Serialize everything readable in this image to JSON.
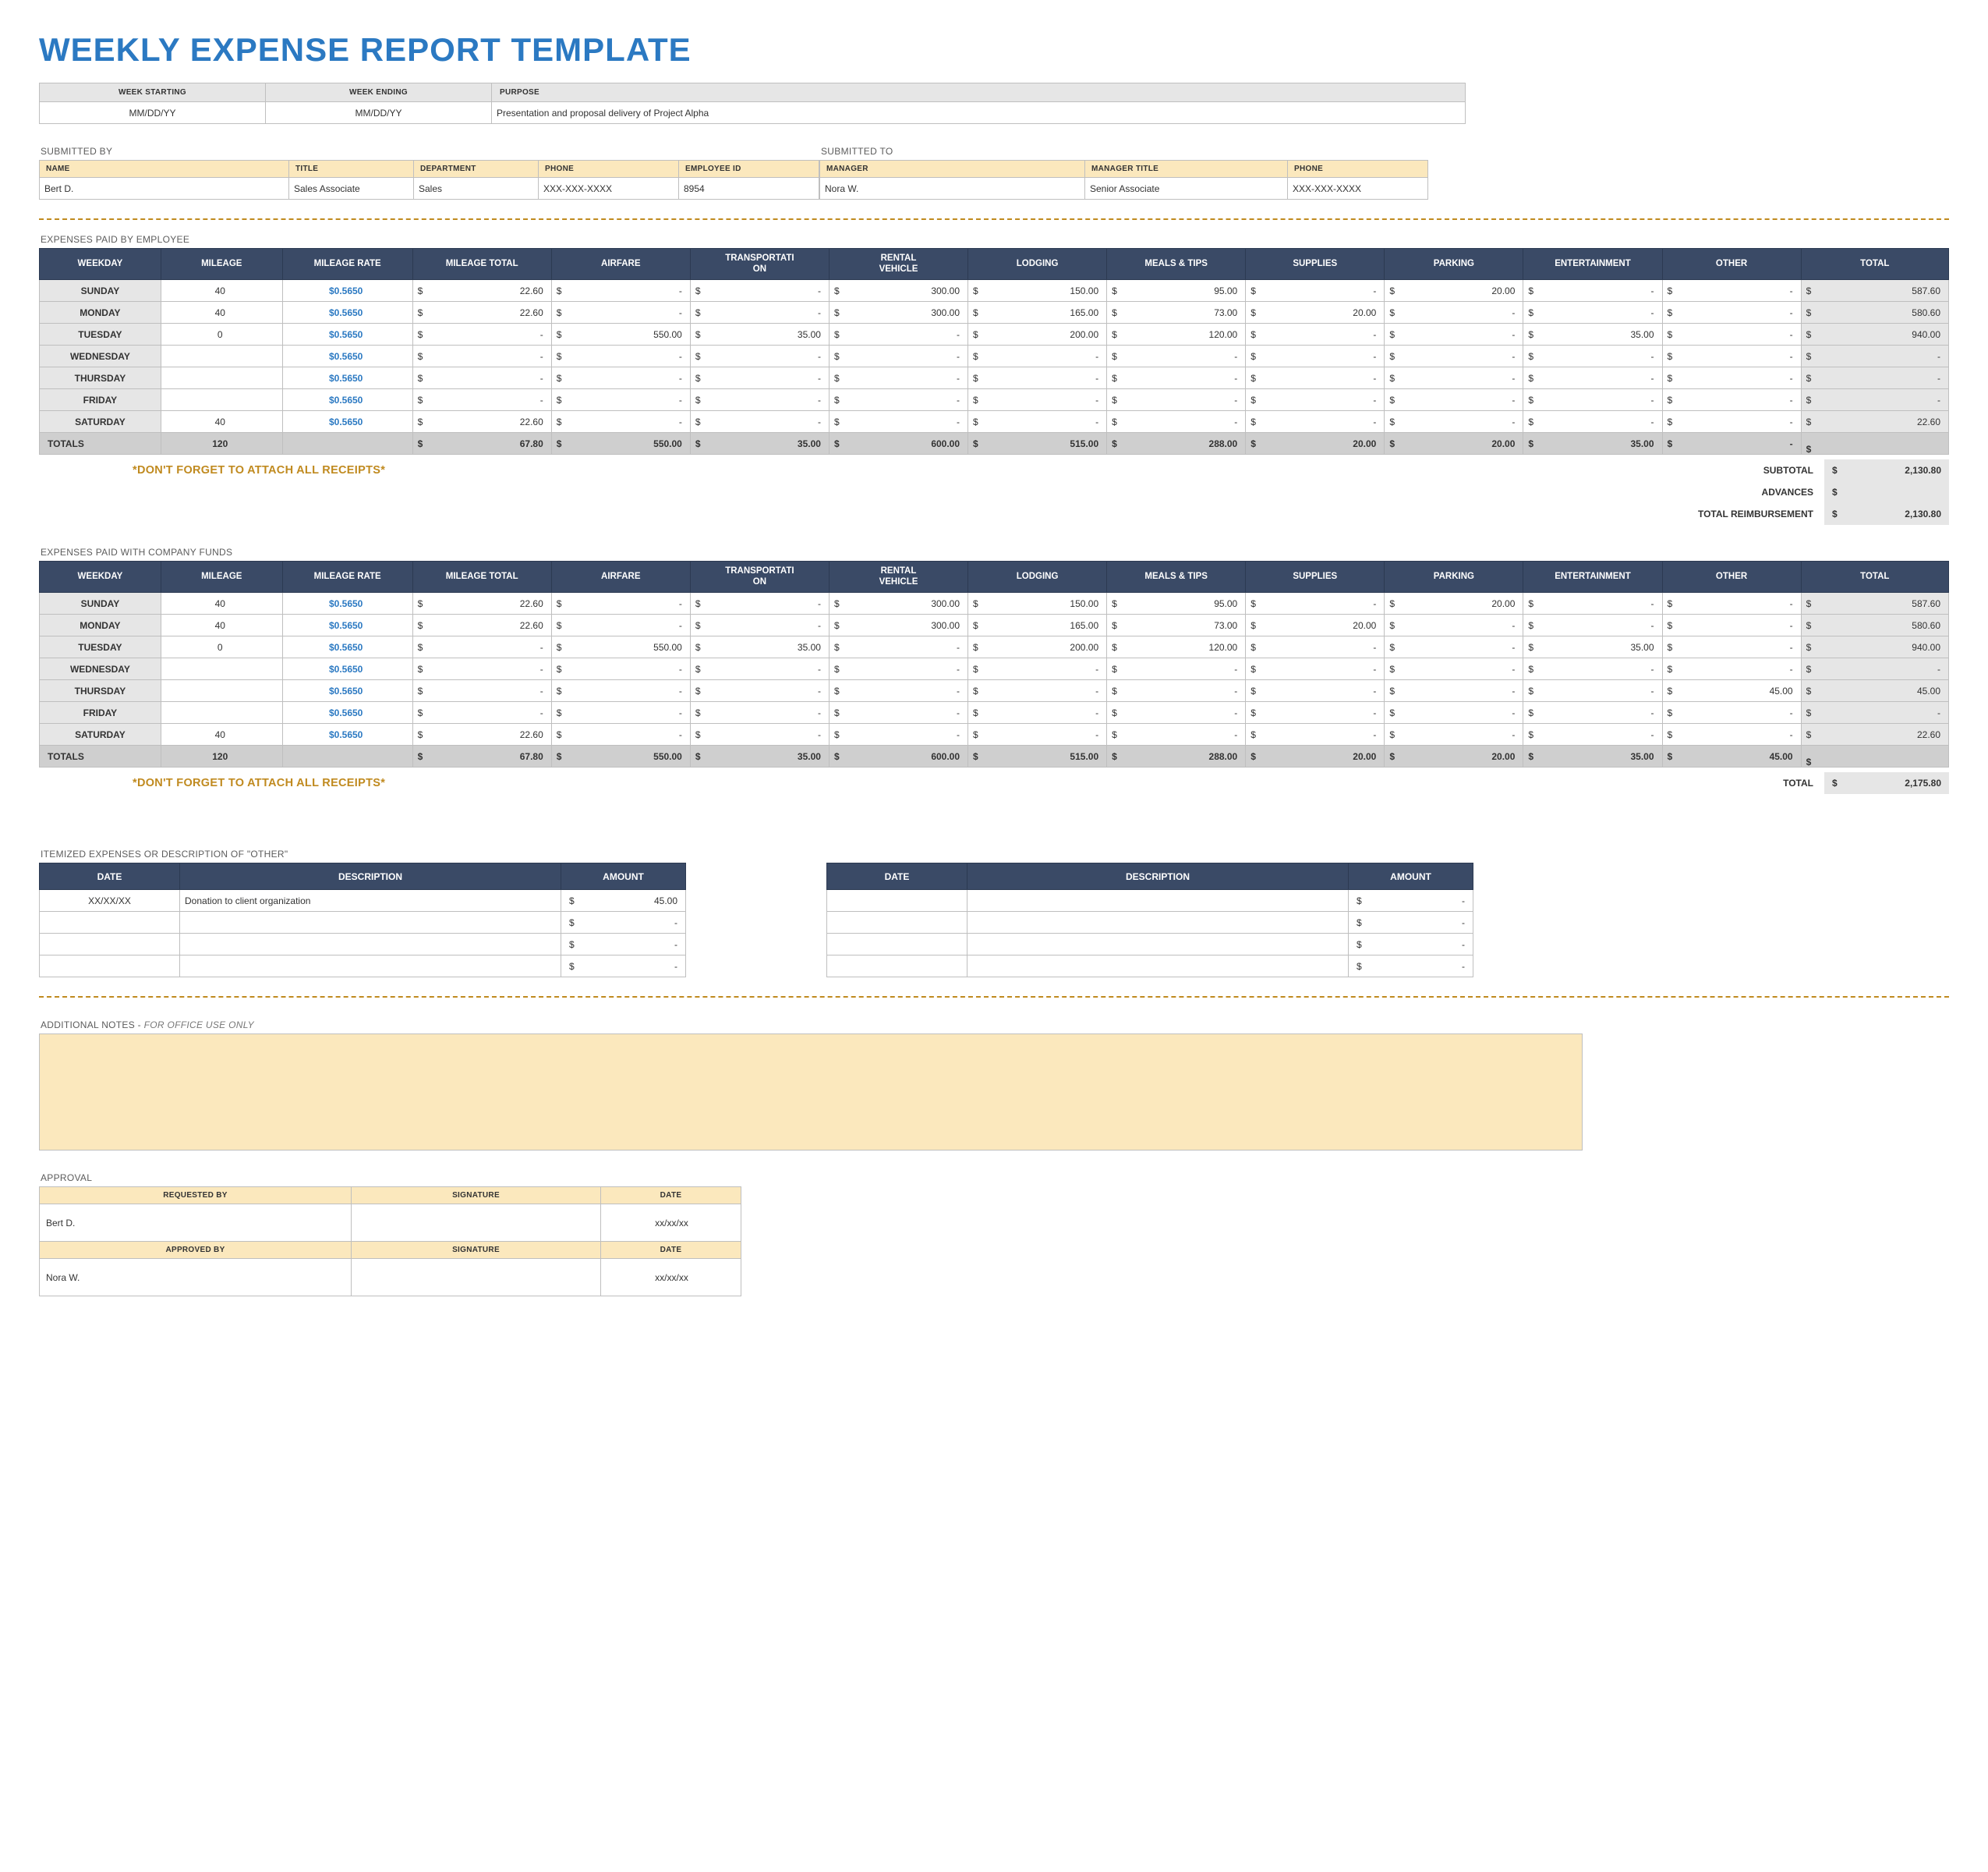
{
  "title": "WEEKLY EXPENSE REPORT TEMPLATE",
  "meta": {
    "labels": {
      "week_start": "WEEK STARTING",
      "week_end": "WEEK ENDING",
      "purpose": "PURPOSE"
    },
    "week_start": "MM/DD/YY",
    "week_end": "MM/DD/YY",
    "purpose": "Presentation and proposal delivery of Project Alpha"
  },
  "parties": {
    "submitted_by_label": "SUBMITTED BY",
    "submitted_to_label": "SUBMITTED TO",
    "by": {
      "headers": [
        "NAME",
        "TITLE",
        "DEPARTMENT",
        "PHONE",
        "EMPLOYEE ID"
      ],
      "values": [
        "Bert D.",
        "Sales Associate",
        "Sales",
        "XXX-XXX-XXXX",
        "8954"
      ]
    },
    "to": {
      "headers": [
        "MANAGER",
        "MANAGER TITLE",
        "PHONE"
      ],
      "values": [
        "Nora W.",
        "Senior Associate",
        "XXX-XXX-XXXX"
      ]
    }
  },
  "exp_headers": [
    "WEEKDAY",
    "MILEAGE",
    "MILEAGE RATE",
    "MILEAGE TOTAL",
    "AIRFARE",
    "TRANSPORTATION",
    "RENTAL VEHICLE",
    "LODGING",
    "MEALS & TIPS",
    "SUPPLIES",
    "PARKING",
    "ENTERTAINMENT",
    "OTHER",
    "TOTAL"
  ],
  "emp": {
    "section_label": "EXPENSES PAID BY EMPLOYEE",
    "rows": [
      {
        "day": "SUNDAY",
        "mileage": "40",
        "rate": "$0.5650",
        "mt": "22.60",
        "air": "-",
        "trans": "-",
        "rent": "300.00",
        "lodg": "150.00",
        "meal": "95.00",
        "supp": "-",
        "park": "20.00",
        "ent": "-",
        "other": "-",
        "total": "587.60"
      },
      {
        "day": "MONDAY",
        "mileage": "40",
        "rate": "$0.5650",
        "mt": "22.60",
        "air": "-",
        "trans": "-",
        "rent": "300.00",
        "lodg": "165.00",
        "meal": "73.00",
        "supp": "20.00",
        "park": "-",
        "ent": "-",
        "other": "-",
        "total": "580.60"
      },
      {
        "day": "TUESDAY",
        "mileage": "0",
        "rate": "$0.5650",
        "mt": "-",
        "air": "550.00",
        "trans": "35.00",
        "rent": "-",
        "lodg": "200.00",
        "meal": "120.00",
        "supp": "-",
        "park": "-",
        "ent": "35.00",
        "other": "-",
        "total": "940.00"
      },
      {
        "day": "WEDNESDAY",
        "mileage": "",
        "rate": "$0.5650",
        "mt": "-",
        "air": "-",
        "trans": "-",
        "rent": "-",
        "lodg": "-",
        "meal": "-",
        "supp": "-",
        "park": "-",
        "ent": "-",
        "other": "-",
        "total": "-"
      },
      {
        "day": "THURSDAY",
        "mileage": "",
        "rate": "$0.5650",
        "mt": "-",
        "air": "-",
        "trans": "-",
        "rent": "-",
        "lodg": "-",
        "meal": "-",
        "supp": "-",
        "park": "-",
        "ent": "-",
        "other": "-",
        "total": "-"
      },
      {
        "day": "FRIDAY",
        "mileage": "",
        "rate": "$0.5650",
        "mt": "-",
        "air": "-",
        "trans": "-",
        "rent": "-",
        "lodg": "-",
        "meal": "-",
        "supp": "-",
        "park": "-",
        "ent": "-",
        "other": "-",
        "total": "-"
      },
      {
        "day": "SATURDAY",
        "mileage": "40",
        "rate": "$0.5650",
        "mt": "22.60",
        "air": "-",
        "trans": "-",
        "rent": "-",
        "lodg": "-",
        "meal": "-",
        "supp": "-",
        "park": "-",
        "ent": "-",
        "other": "-",
        "total": "22.60"
      }
    ],
    "totals": {
      "label": "TOTALS",
      "mileage": "120",
      "mt": "67.80",
      "air": "550.00",
      "trans": "35.00",
      "rent": "600.00",
      "lodg": "515.00",
      "meal": "288.00",
      "supp": "20.00",
      "park": "20.00",
      "ent": "35.00",
      "other": "-",
      "total": ""
    },
    "summary": {
      "subtotal_label": "SUBTOTAL",
      "advances_label": "ADVANCES",
      "reimb_label": "TOTAL REIMBURSEMENT",
      "subtotal": "2,130.80",
      "advances": "",
      "reimb": "2,130.80"
    },
    "receipt_note": "*DON'T FORGET TO ATTACH ALL RECEIPTS*"
  },
  "comp": {
    "section_label": "EXPENSES PAID WITH COMPANY FUNDS",
    "rows": [
      {
        "day": "SUNDAY",
        "mileage": "40",
        "rate": "$0.5650",
        "mt": "22.60",
        "air": "-",
        "trans": "-",
        "rent": "300.00",
        "lodg": "150.00",
        "meal": "95.00",
        "supp": "-",
        "park": "20.00",
        "ent": "-",
        "other": "-",
        "total": "587.60"
      },
      {
        "day": "MONDAY",
        "mileage": "40",
        "rate": "$0.5650",
        "mt": "22.60",
        "air": "-",
        "trans": "-",
        "rent": "300.00",
        "lodg": "165.00",
        "meal": "73.00",
        "supp": "20.00",
        "park": "-",
        "ent": "-",
        "other": "-",
        "total": "580.60"
      },
      {
        "day": "TUESDAY",
        "mileage": "0",
        "rate": "$0.5650",
        "mt": "-",
        "air": "550.00",
        "trans": "35.00",
        "rent": "-",
        "lodg": "200.00",
        "meal": "120.00",
        "supp": "-",
        "park": "-",
        "ent": "35.00",
        "other": "-",
        "total": "940.00"
      },
      {
        "day": "WEDNESDAY",
        "mileage": "",
        "rate": "$0.5650",
        "mt": "-",
        "air": "-",
        "trans": "-",
        "rent": "-",
        "lodg": "-",
        "meal": "-",
        "supp": "-",
        "park": "-",
        "ent": "-",
        "other": "-",
        "total": "-"
      },
      {
        "day": "THURSDAY",
        "mileage": "",
        "rate": "$0.5650",
        "mt": "-",
        "air": "-",
        "trans": "-",
        "rent": "-",
        "lodg": "-",
        "meal": "-",
        "supp": "-",
        "park": "-",
        "ent": "-",
        "other": "45.00",
        "total": "45.00"
      },
      {
        "day": "FRIDAY",
        "mileage": "",
        "rate": "$0.5650",
        "mt": "-",
        "air": "-",
        "trans": "-",
        "rent": "-",
        "lodg": "-",
        "meal": "-",
        "supp": "-",
        "park": "-",
        "ent": "-",
        "other": "-",
        "total": "-"
      },
      {
        "day": "SATURDAY",
        "mileage": "40",
        "rate": "$0.5650",
        "mt": "22.60",
        "air": "-",
        "trans": "-",
        "rent": "-",
        "lodg": "-",
        "meal": "-",
        "supp": "-",
        "park": "-",
        "ent": "-",
        "other": "-",
        "total": "22.60"
      }
    ],
    "totals": {
      "label": "TOTALS",
      "mileage": "120",
      "mt": "67.80",
      "air": "550.00",
      "trans": "35.00",
      "rent": "600.00",
      "lodg": "515.00",
      "meal": "288.00",
      "supp": "20.00",
      "park": "20.00",
      "ent": "35.00",
      "other": "45.00",
      "total": ""
    },
    "grand_total_label": "TOTAL",
    "grand_total": "2,175.80",
    "receipt_note": "*DON'T FORGET TO ATTACH ALL RECEIPTS*"
  },
  "itemized": {
    "section_label": "ITEMIZED EXPENSES OR DESCRIPTION OF \"OTHER\"",
    "headers": [
      "DATE",
      "DESCRIPTION",
      "AMOUNT"
    ],
    "left": [
      {
        "date": "XX/XX/XX",
        "desc": "Donation to client organization",
        "amt": "45.00"
      },
      {
        "date": "",
        "desc": "",
        "amt": "-"
      },
      {
        "date": "",
        "desc": "",
        "amt": "-"
      },
      {
        "date": "",
        "desc": "",
        "amt": "-"
      }
    ],
    "right": [
      {
        "date": "",
        "desc": "",
        "amt": "-"
      },
      {
        "date": "",
        "desc": "",
        "amt": "-"
      },
      {
        "date": "",
        "desc": "",
        "amt": "-"
      },
      {
        "date": "",
        "desc": "",
        "amt": "-"
      }
    ]
  },
  "notes": {
    "label_a": "ADDITIONAL NOTES - ",
    "label_b": "FOR OFFICE USE ONLY"
  },
  "approval": {
    "section_label": "APPROVAL",
    "headers": [
      "REQUESTED BY",
      "SIGNATURE",
      "DATE",
      "APPROVED BY",
      "SIGNATURE",
      "DATE"
    ],
    "requested_by": "Bert D.",
    "requested_date": "xx/xx/xx",
    "approved_by": "Nora W.",
    "approved_date": "xx/xx/xx"
  }
}
